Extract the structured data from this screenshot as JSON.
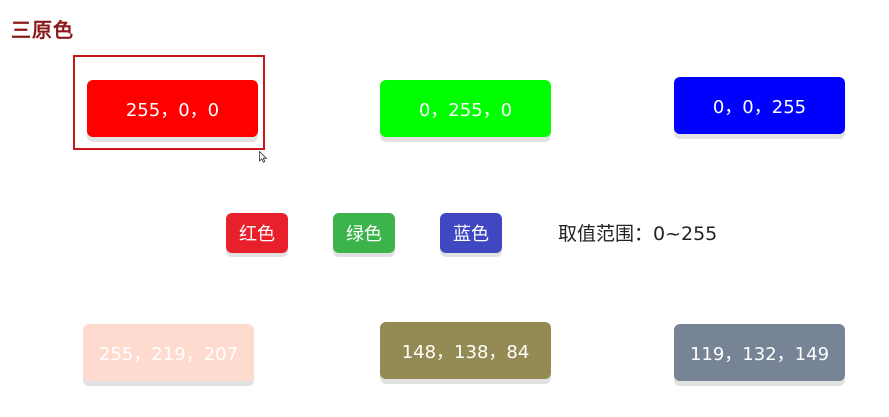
{
  "title": "三原色",
  "primaries": [
    {
      "label": "255，0，0",
      "color": "#ff0000"
    },
    {
      "label": "0，255，0",
      "color": "#00ff00"
    },
    {
      "label": "0，0，255",
      "color": "#0000ff"
    }
  ],
  "chips": [
    {
      "label": "红色",
      "color": "#e8202b"
    },
    {
      "label": "绿色",
      "color": "#3cb44b"
    },
    {
      "label": "蓝色",
      "color": "#3f48c0"
    }
  ],
  "range_text": "取值范围：0~255",
  "mixes": [
    {
      "label": "255，219，207",
      "color": "#ffdbcf"
    },
    {
      "label": "148，138，84",
      "color": "#948a54"
    },
    {
      "label": "119，132，149",
      "color": "#778495"
    }
  ],
  "highlight_color": "#c8161d"
}
